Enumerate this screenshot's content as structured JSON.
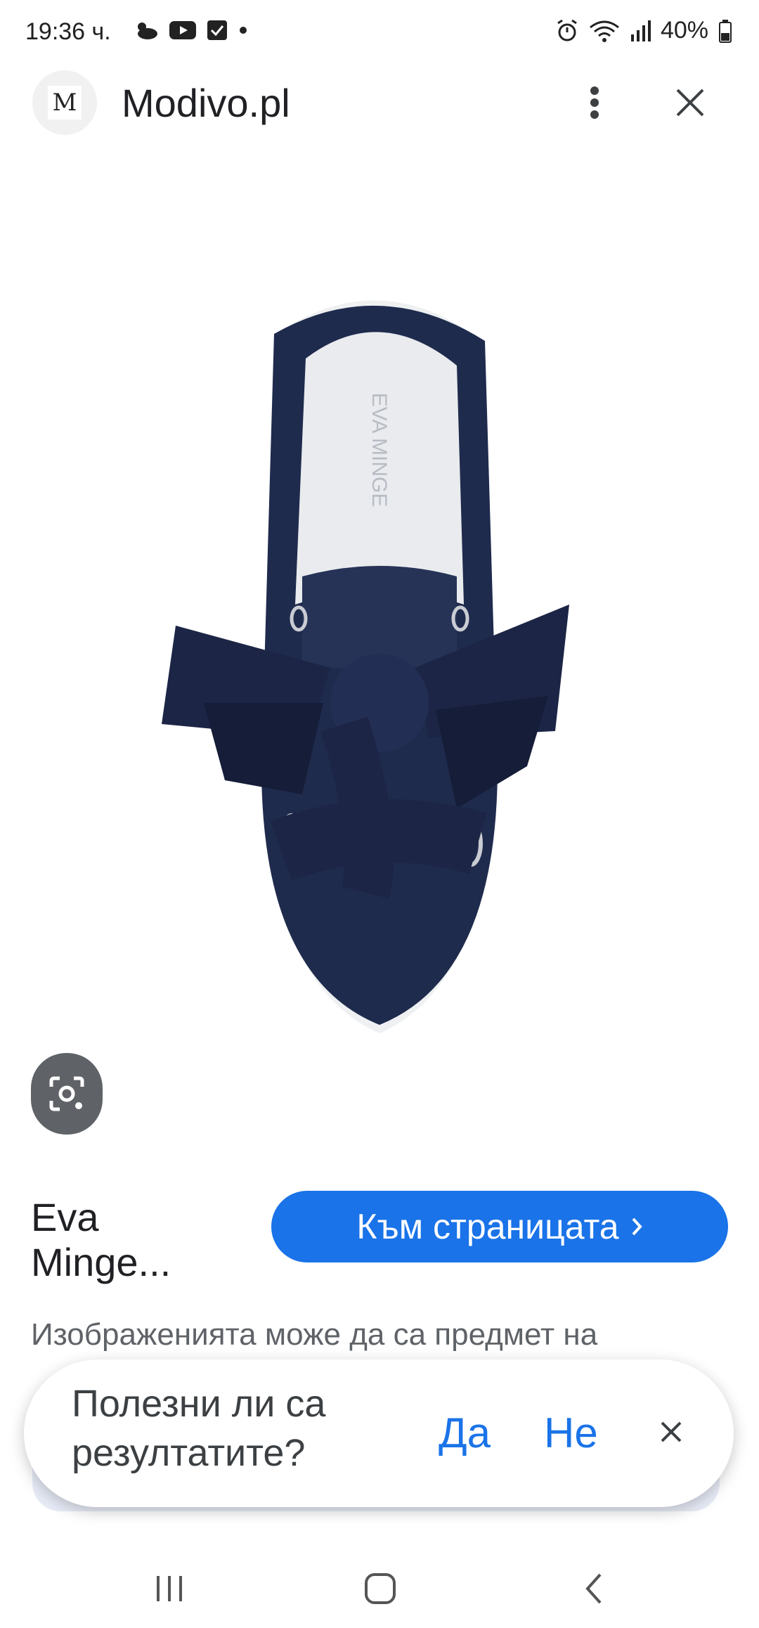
{
  "status_bar": {
    "time": "19:36 ч.",
    "battery": "40%",
    "icons": [
      "weather-icon",
      "youtube-icon",
      "checkbox-icon",
      "dot-icon",
      "alarm-icon",
      "wifi-icon",
      "signal-icon",
      "battery-icon"
    ]
  },
  "header": {
    "logo_letter": "M",
    "site_title": "Modivo.pl"
  },
  "product": {
    "name": "Eva Minge...",
    "visit_label": "Към страницата",
    "disclaimer": "Изображенията може да са предмет на"
  },
  "feedback": {
    "question": "Полезни ли са резултатите?",
    "yes": "Да",
    "no": "Не"
  },
  "colors": {
    "accent": "#1a73e8",
    "lens_button": "#5f6368",
    "shoe": "#1f2b4d"
  }
}
